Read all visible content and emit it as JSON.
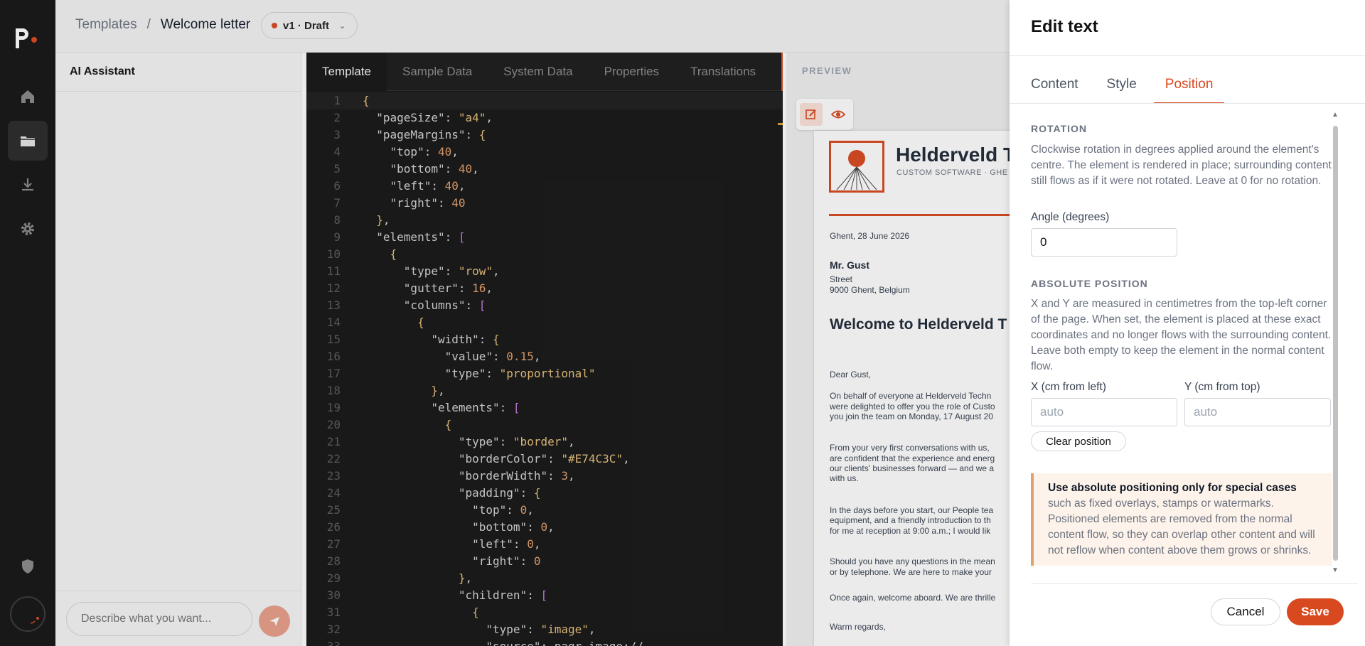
{
  "breadcrumb": {
    "parent": "Templates",
    "separator": "/",
    "current": "Welcome letter"
  },
  "version": {
    "label": "v1 · Draft"
  },
  "sidebar": {
    "items": [
      {
        "icon": "home-icon"
      },
      {
        "icon": "folder-icon"
      },
      {
        "icon": "download-icon"
      },
      {
        "icon": "gear-icon"
      }
    ],
    "bottom_icon": "shield-icon"
  },
  "ai_assistant": {
    "title": "AI Assistant",
    "input_placeholder": "Describe what you want..."
  },
  "editor": {
    "tabs": [
      "Template",
      "Sample Data",
      "System Data",
      "Properties",
      "Translations"
    ],
    "active_tab": "Template",
    "lines": [
      "{",
      "  \"pageSize\": \"a4\",",
      "  \"pageMargins\": {",
      "    \"top\": 40,",
      "    \"bottom\": 40,",
      "    \"left\": 40,",
      "    \"right\": 40",
      "  },",
      "  \"elements\": [",
      "    {",
      "      \"type\": \"row\",",
      "      \"gutter\": 16,",
      "      \"columns\": [",
      "        {",
      "          \"width\": {",
      "            \"value\": 0.15,",
      "            \"type\": \"proportional\"",
      "          },",
      "          \"elements\": [",
      "            {",
      "              \"type\": \"border\",",
      "              \"borderColor\": \"#E74C3C\",",
      "              \"borderWidth\": 3,",
      "              \"padding\": {",
      "                \"top\": 0,",
      "                \"bottom\": 0,",
      "                \"left\": 0,",
      "                \"right\": 0",
      "              },",
      "              \"children\": [",
      "                {",
      "                  \"type\": \"image\",",
      "                  \"source\": \"pagr-image://"
    ]
  },
  "preview": {
    "label": "PREVIEW",
    "company": "Helderveld T",
    "company_sub": "CUSTOM SOFTWARE · GHE",
    "date": "Ghent, 28 June 2026",
    "recipient_name": "Mr. Gust",
    "recipient_street": "Street",
    "recipient_city": "9000 Ghent, Belgium",
    "heading": "Welcome to Helderveld T",
    "greeting": "Dear Gust,",
    "para1": [
      "On behalf of everyone at Helderveld Techn",
      "were delighted to offer you the role of Custo",
      "you join the team on Monday, 17 August 20"
    ],
    "para2": [
      "From your very first conversations with us, ",
      "are confident that the experience and energ",
      "our clients' businesses forward — and we a",
      "with us."
    ],
    "para3": [
      "In the days before you start, our People tea",
      "equipment, and a friendly introduction to th",
      "for me at reception at 9:00 a.m.; I would lik"
    ],
    "para4": [
      "Should you have any questions in the mean",
      "or by telephone. We are here to make your"
    ],
    "para5": "Once again, welcome aboard. We are thrille",
    "closing": "Warm regards,"
  },
  "drawer": {
    "title": "Edit text",
    "tabs": [
      "Content",
      "Style",
      "Position"
    ],
    "active_tab": "Position",
    "rotation": {
      "title": "ROTATION",
      "help": "Clockwise rotation in degrees applied around the element's centre. The element is rendered in place; surrounding content still flows as if it were not rotated. Leave at 0 for no rotation.",
      "angle_label": "Angle (degrees)",
      "angle_value": "0"
    },
    "absolute_position": {
      "title": "ABSOLUTE POSITION",
      "help": "X and Y are measured in centimetres from the top-left corner of the page. When set, the element is placed at these exact coordinates and no longer flows with the surrounding content. Leave both empty to keep the element in the normal content flow.",
      "x_label": "X (cm from left)",
      "y_label": "Y (cm from top)",
      "x_placeholder": "auto",
      "y_placeholder": "auto",
      "clear_label": "Clear position"
    },
    "warning": {
      "bold": "Use absolute positioning only for special cases",
      "text": " such as fixed overlays, stamps or watermarks. Positioned elements are removed from the normal content flow, so they can overlap other content and will not reflow when content above them grows or shrinks."
    },
    "cancel_label": "Cancel",
    "save_label": "Save"
  },
  "colors": {
    "accent": "#d9491f",
    "rail": "#151515",
    "editor_bg": "#161616",
    "warning_bg": "#fdf3ea"
  }
}
